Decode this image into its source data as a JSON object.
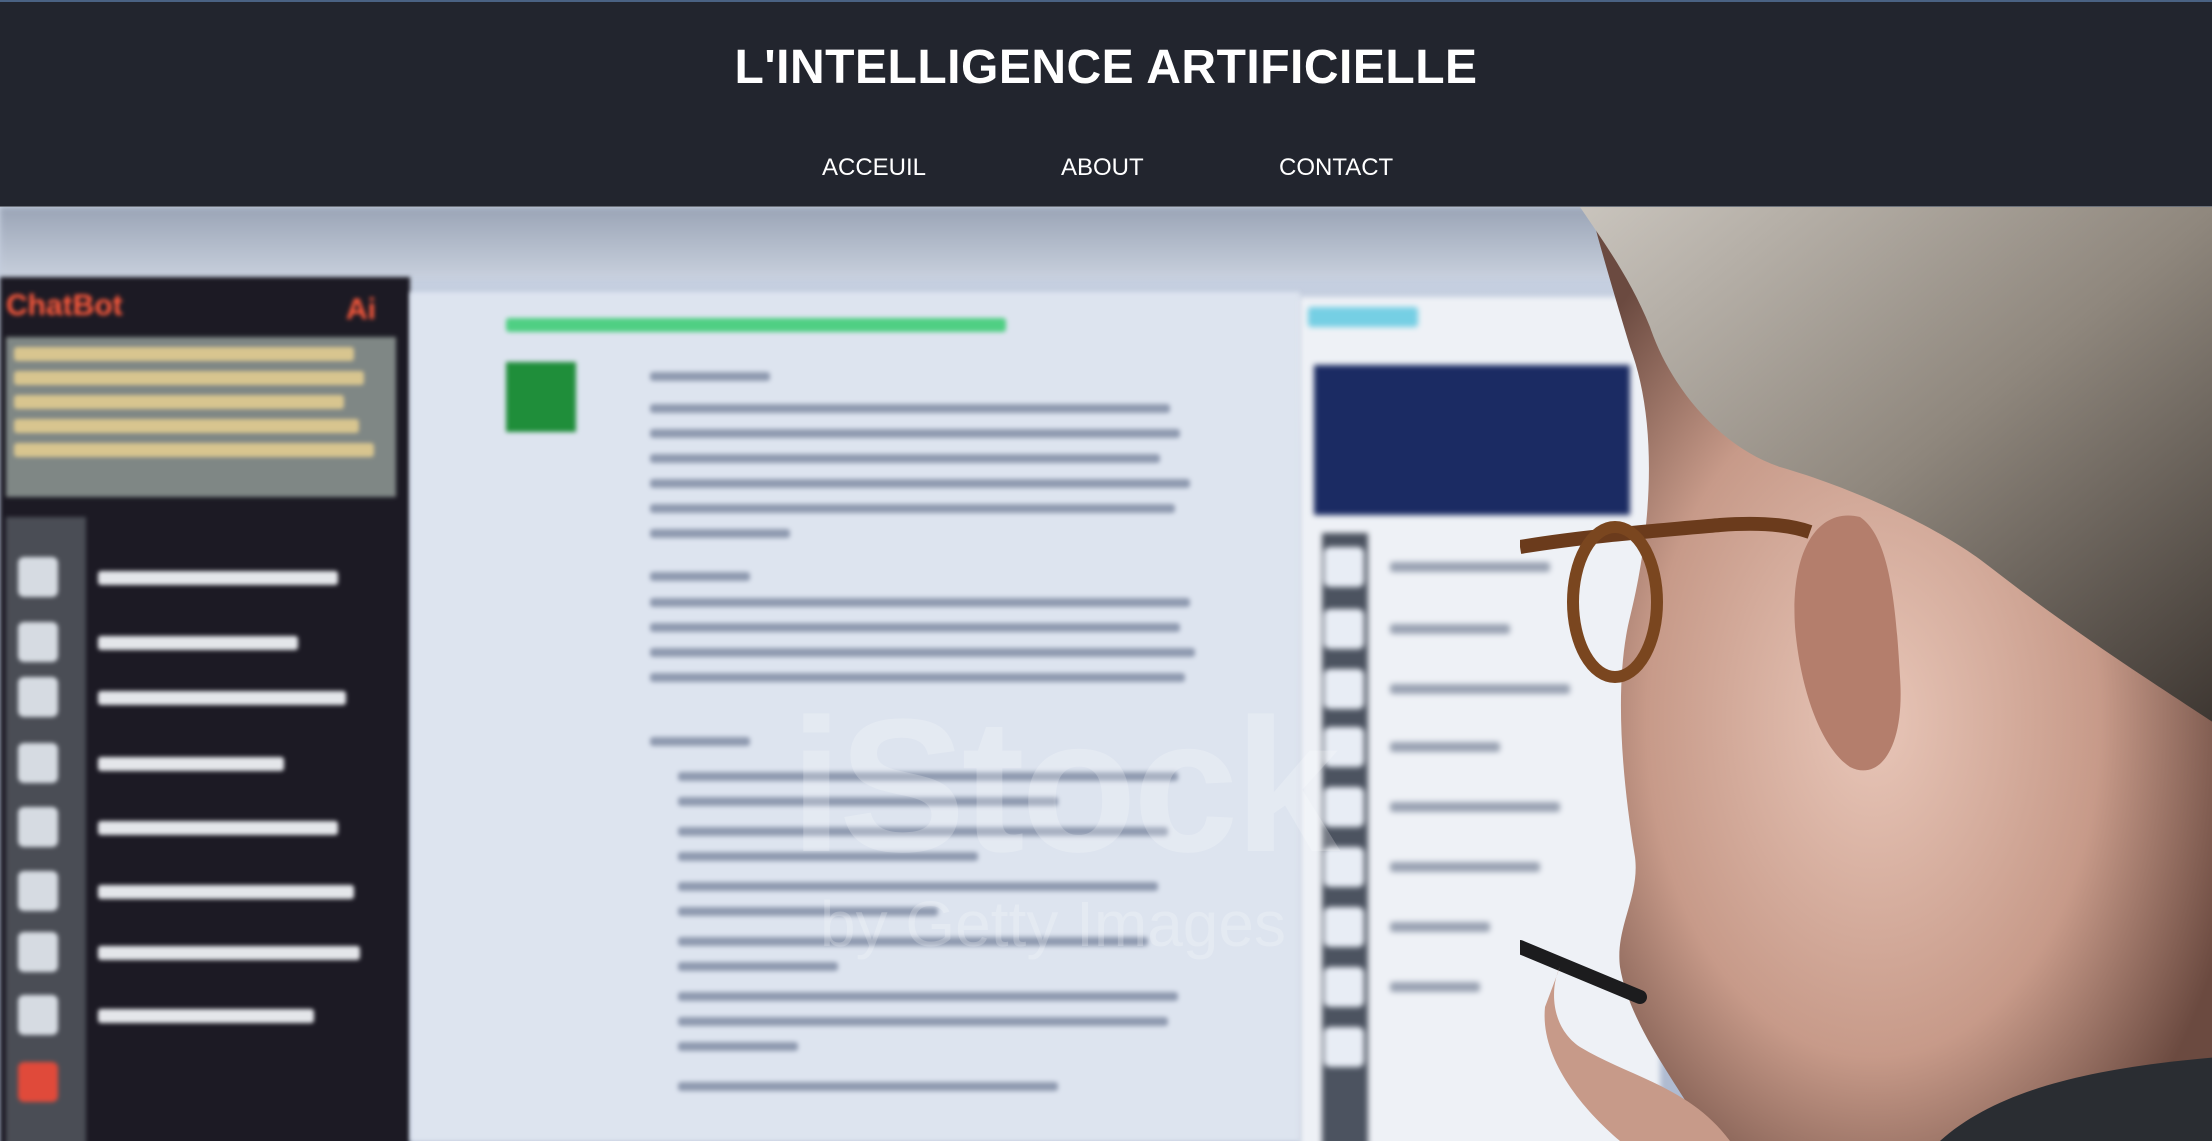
{
  "header": {
    "title": "L'INTELLIGENCE ARTIFICIELLE"
  },
  "nav": {
    "items": [
      {
        "label": "ACCEUIL"
      },
      {
        "label": "ABOUT"
      },
      {
        "label": "CONTACT"
      }
    ]
  },
  "hero": {
    "image": "hero-photo-man-reading-ai-chatbot-screen",
    "watermark": {
      "brand": "iStock",
      "sub": "by Getty Images"
    },
    "screen": {
      "chat_title": "ChatBot",
      "chat_badge": "Ai"
    }
  },
  "colors": {
    "header_bg": "#22252e",
    "nav_text": "#ffffff",
    "title_text": "#ffffff",
    "accent_orange": "#ff5a3c",
    "accent_green": "#1f8e3a"
  }
}
